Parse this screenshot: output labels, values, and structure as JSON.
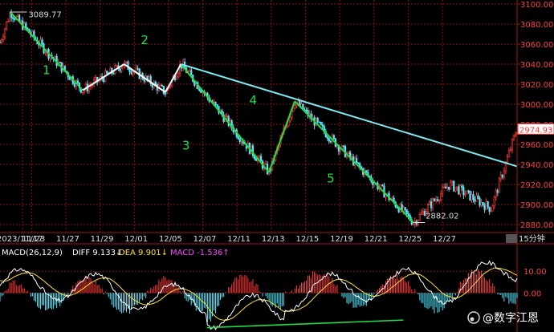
{
  "chart_data": [
    {
      "type": "candlestick",
      "axis": {
        "y_ticks": [
          2880,
          2900,
          2920,
          2940,
          2960,
          2980,
          3000,
          3020,
          3040,
          3060,
          3080,
          3100
        ],
        "y_tick_labels": [
          "2880.00",
          "2900.00",
          "2920.00",
          "2940.00",
          "2960.00",
          "2980.00",
          "3000.00",
          "3020.00",
          "3040.00",
          "3060.00",
          "3080.00",
          "3100.00"
        ],
        "x_labels": [
          "2023/11/17",
          "11/23",
          "11/27",
          "11/29",
          "12/01",
          "12/05",
          "12/07",
          "12/11",
          "12/13",
          "12/15",
          "12/19",
          "12/21",
          "12/25",
          "12/27"
        ],
        "ylim": [
          2872,
          3104
        ],
        "timeframe_label": "15分钟"
      },
      "price_marks": {
        "high_label": "3089.77",
        "low_label": "2882.02",
        "current_label": "2974.93"
      },
      "waves": {
        "labels": [
          "1",
          "2",
          "3",
          "4",
          "5"
        ],
        "points": [
          [
            0.02,
            3092
          ],
          [
            0.16,
            3014
          ],
          [
            0.24,
            3040
          ],
          [
            0.32,
            3012
          ],
          [
            0.35,
            3040
          ],
          [
            0.52,
            2932
          ],
          [
            0.57,
            3003
          ],
          [
            0.8,
            2882
          ]
        ]
      },
      "trendline": {
        "start": [
          0.35,
          3040
        ],
        "end": [
          1.0,
          2938
        ]
      },
      "colors": {
        "up": "#ff3b3b",
        "down": "#54e8ff",
        "wave": "#22dd44",
        "trend": "#7fe8ef",
        "current": "#ff3333"
      }
    },
    {
      "type": "macd",
      "legend": {
        "name": "MACD(26,12,9)",
        "diff": "DIFF 9.133↓",
        "dea": "DEA 9.901↓",
        "macd": "MACD -1.536↑"
      },
      "y_ticks": [
        "10.00",
        "0.00"
      ],
      "ylim": [
        -18,
        16
      ],
      "colors": {
        "diff": "#ffffff",
        "dea": "#ffe033",
        "macd_label": "#ff44ff",
        "up": "#ff3b3b",
        "down": "#54e8ff",
        "divergence": "#22dd44"
      }
    }
  ],
  "watermark": "@数字江恩"
}
